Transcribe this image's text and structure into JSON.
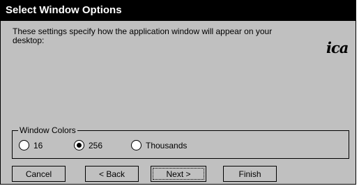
{
  "window": {
    "title": "Select Window Options",
    "description": "These settings specify how the application window will appear on your desktop:",
    "logo_text": "ica"
  },
  "colors_group": {
    "legend": "Window Colors",
    "options": [
      {
        "label": "16",
        "selected": false
      },
      {
        "label": "256",
        "selected": true
      },
      {
        "label": "Thousands",
        "selected": false
      }
    ]
  },
  "buttons": {
    "cancel": "Cancel",
    "back": "< Back",
    "next": "Next >",
    "finish": "Finish"
  }
}
